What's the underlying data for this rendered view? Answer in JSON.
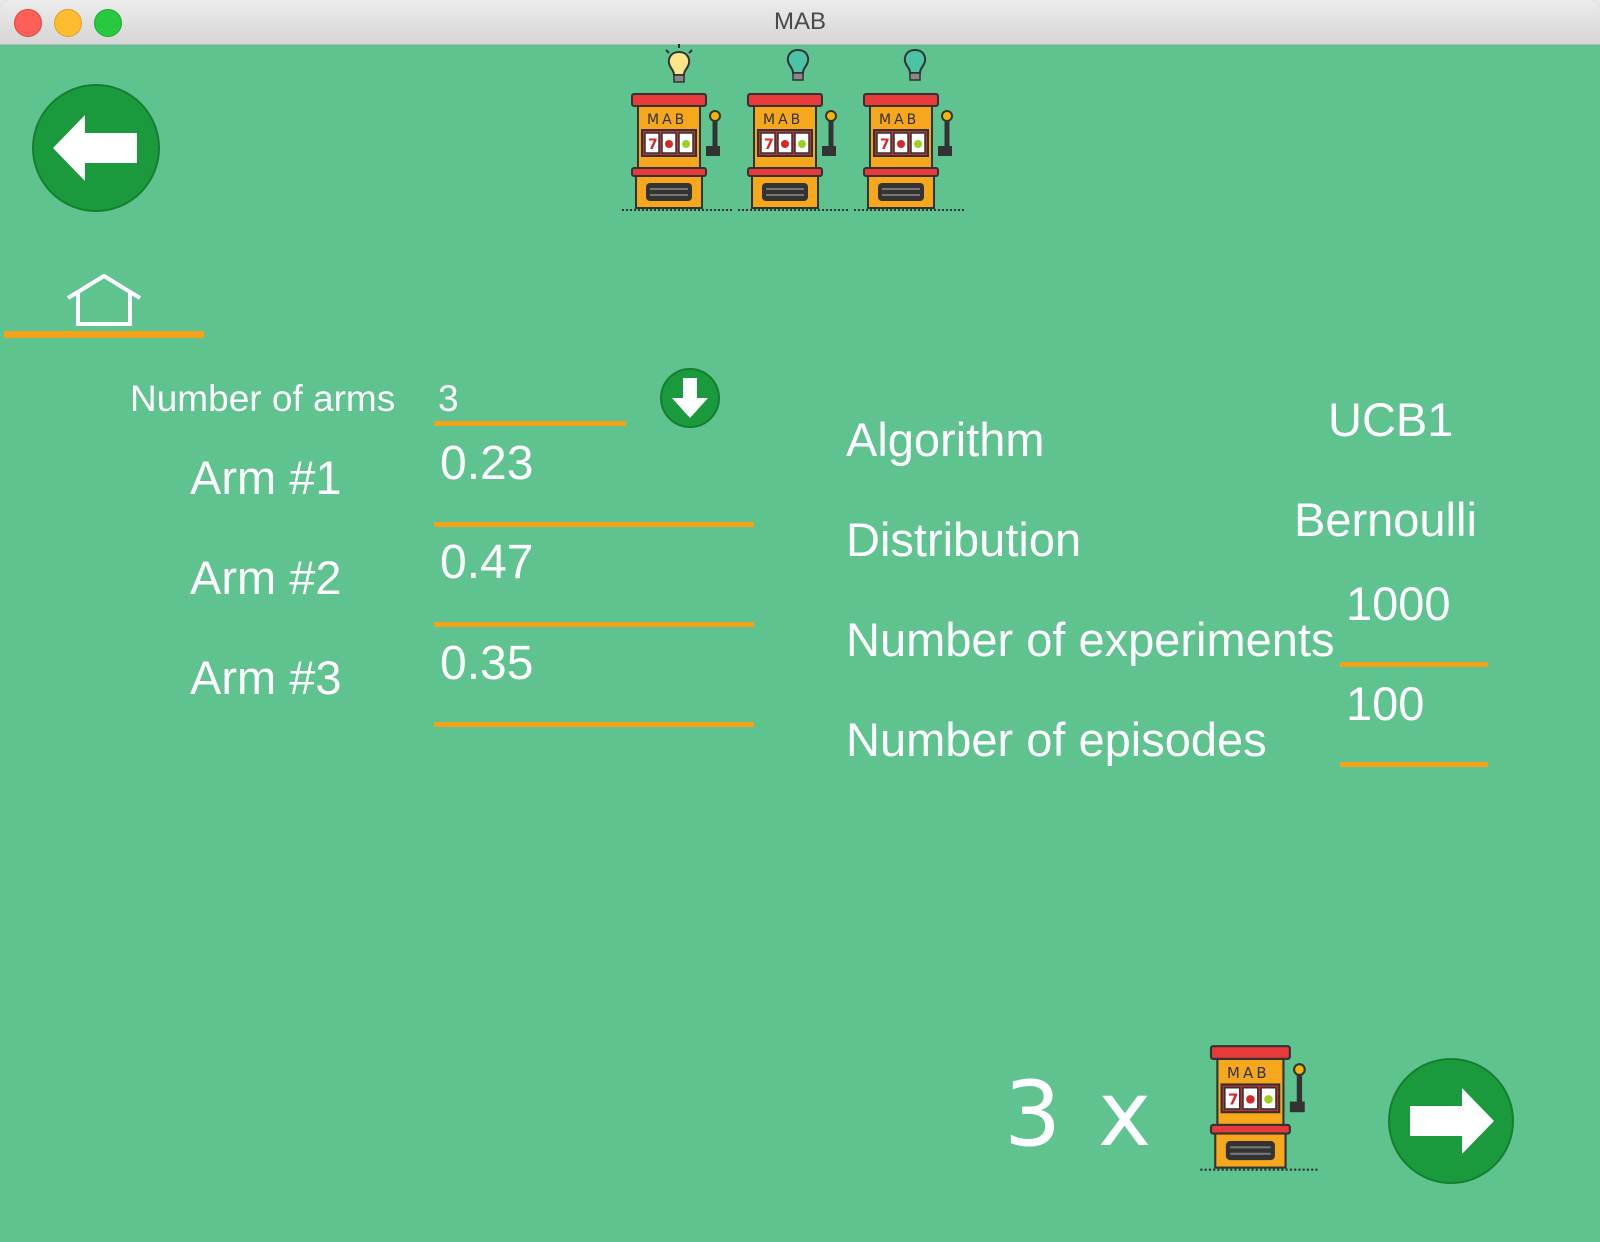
{
  "window": {
    "title": "MAB"
  },
  "header": {
    "machines": [
      {
        "label": "MAB",
        "bulb": "lit-bulb-icon"
      },
      {
        "label": "MAB",
        "bulb": "unlit-bulb-icon"
      },
      {
        "label": "MAB",
        "bulb": "unlit-bulb-icon"
      }
    ]
  },
  "nav": {
    "back_icon": "arrow-left-icon",
    "home_icon": "home-icon",
    "next_icon": "arrow-right-icon"
  },
  "arms": {
    "count_label": "Number of arms",
    "count_value": "3",
    "download_icon": "arrow-down-icon",
    "items": [
      {
        "label": "Arm #1",
        "value": "0.23"
      },
      {
        "label": "Arm #2",
        "value": "0.47"
      },
      {
        "label": "Arm #3",
        "value": "0.35"
      }
    ]
  },
  "settings": {
    "algorithm_label": "Algorithm",
    "algorithm_value": "UCB1",
    "distribution_label": "Distribution",
    "distribution_value": "Bernoulli",
    "experiments_label": "Number of experiments",
    "experiments_value": "1000",
    "episodes_label": "Number of episodes",
    "episodes_value": "100"
  },
  "summary": {
    "count": "3",
    "times": "x",
    "machine_label": "MAB"
  },
  "colors": {
    "background": "#5ec38f",
    "accent": "#f5a21b",
    "button": "#1a9a3c"
  }
}
